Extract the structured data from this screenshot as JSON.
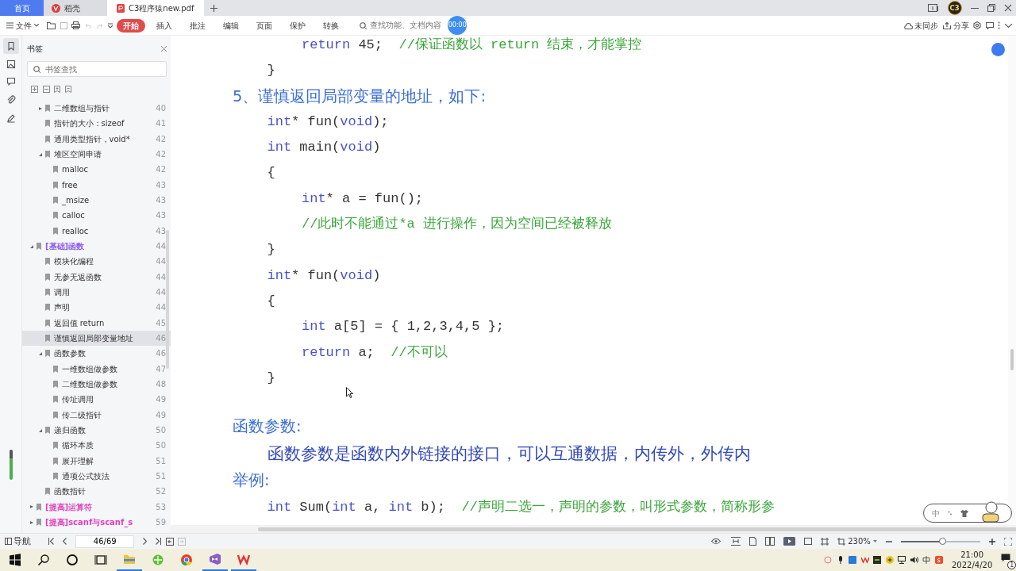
{
  "tabs": [
    {
      "label": "首页",
      "kind": "home",
      "selected": false
    },
    {
      "label": "稻壳",
      "kind": "docer",
      "selected": false
    },
    {
      "label": "C3程序猿new.pdf",
      "kind": "pdf",
      "selected": true
    }
  ],
  "window": {
    "avatar": "C3"
  },
  "toolbar": {
    "file_menu": "文件",
    "menu": [
      {
        "label": "开始",
        "selected": true
      },
      {
        "label": "插入",
        "selected": false
      },
      {
        "label": "批注",
        "selected": false
      },
      {
        "label": "编辑",
        "selected": false
      },
      {
        "label": "页面",
        "selected": false
      },
      {
        "label": "保护",
        "selected": false
      },
      {
        "label": "转换",
        "selected": false
      }
    ],
    "search": {
      "placeholder": "查找功能、文档内容"
    },
    "timer": "00:00",
    "sync": "未同步",
    "share": "分享"
  },
  "sidebar": {
    "title": "书签",
    "search": {
      "placeholder": "书签查找"
    },
    "continued_items": [
      {
        "label": "二维数组与指针",
        "page": "40",
        "expanded": false
      },
      {
        "label": "指针的大小：sizeof",
        "page": "41"
      },
      {
        "label": "通用类型指针，void*",
        "page": "42"
      },
      {
        "label": "堆区空间申请",
        "page": "42",
        "expanded": true,
        "children": [
          {
            "label": "malloc",
            "page": "42"
          },
          {
            "label": "free",
            "page": "43"
          },
          {
            "label": "_msize",
            "page": "43"
          },
          {
            "label": "calloc",
            "page": "43"
          },
          {
            "label": "realloc",
            "page": "43"
          }
        ]
      }
    ],
    "items": [
      {
        "label": "[基础]函数",
        "page": "44",
        "color": "#8a5cf0",
        "expanded": true,
        "children": [
          {
            "label": "模块化编程",
            "page": "44"
          },
          {
            "label": "无参无返函数",
            "page": "44"
          },
          {
            "label": "调用",
            "page": "44"
          },
          {
            "label": "声明",
            "page": "44"
          },
          {
            "label": "返回值 return",
            "page": "45"
          },
          {
            "label": "谨慎返回局部变量地址",
            "page": "46",
            "selected": true
          },
          {
            "label": "函数参数",
            "page": "46",
            "expanded": true,
            "children": [
              {
                "label": "一维数组做参数",
                "page": "47"
              },
              {
                "label": "二维数组做参数",
                "page": "48"
              },
              {
                "label": "传址调用",
                "page": "49"
              },
              {
                "label": "传二级指针",
                "page": "49"
              }
            ]
          },
          {
            "label": "递归函数",
            "page": "50",
            "expanded": true,
            "children": [
              {
                "label": "循环本质",
                "page": "50"
              },
              {
                "label": "展开理解",
                "page": "51"
              },
              {
                "label": "通项公式技法",
                "page": "51"
              }
            ]
          },
          {
            "label": "函数指针",
            "page": "52"
          }
        ]
      },
      {
        "label": "[提高]运算符",
        "page": "53",
        "color": "#e040c0",
        "expanded": false
      },
      {
        "label": "[提高]scanf与scanf_s",
        "page": "59",
        "color": "#e040c0",
        "expanded": false
      }
    ]
  },
  "document": {
    "sections": [
      {
        "items": [
          {
            "kind": "group",
            "lines": [
              {
                "kind": "group",
                "lines": [
                  {
                    "kind": "code",
                    "segments": [
                      {
                        "kind": "keyword",
                        "text": "return"
                      },
                      {
                        "kind": "plain",
                        "text": " 45;  "
                      },
                      {
                        "kind": "comment",
                        "text": "//保证函数以 return 结束，才能掌控"
                      }
                    ]
                  }
                ]
              },
              {
                "kind": "code",
                "segments": [
                  {
                    "kind": "plain",
                    "text": "}"
                  }
                ]
              }
            ]
          },
          {
            "kind": "heading",
            "text": "5、谨慎返回局部变量的地址，如下:"
          },
          {
            "kind": "group",
            "lines": [
              {
                "kind": "code",
                "segments": [
                  {
                    "kind": "keyword",
                    "text": "int"
                  },
                  {
                    "kind": "plain",
                    "text": "* fun("
                  },
                  {
                    "kind": "keyword",
                    "text": "void"
                  },
                  {
                    "kind": "plain",
                    "text": ");"
                  }
                ]
              },
              {
                "kind": "code",
                "segments": [
                  {
                    "kind": "keyword",
                    "text": "int"
                  },
                  {
                    "kind": "plain",
                    "text": " main("
                  },
                  {
                    "kind": "keyword",
                    "text": "void"
                  },
                  {
                    "kind": "plain",
                    "text": ")"
                  }
                ]
              },
              {
                "kind": "code",
                "segments": [
                  {
                    "kind": "plain",
                    "text": "{"
                  }
                ]
              },
              {
                "kind": "group",
                "lines": [
                  {
                    "kind": "code",
                    "segments": [
                      {
                        "kind": "keyword",
                        "text": "int"
                      },
                      {
                        "kind": "plain",
                        "text": "* a = fun();"
                      }
                    ]
                  },
                  {
                    "kind": "code",
                    "segments": [
                      {
                        "kind": "comment",
                        "text": "//此时不能通过*a 进行操作，因为空间已经被释放"
                      }
                    ]
                  }
                ]
              },
              {
                "kind": "code",
                "segments": [
                  {
                    "kind": "plain",
                    "text": "}"
                  }
                ]
              },
              {
                "kind": "code",
                "segments": [
                  {
                    "kind": "keyword",
                    "text": "int"
                  },
                  {
                    "kind": "plain",
                    "text": "* fun("
                  },
                  {
                    "kind": "keyword",
                    "text": "void"
                  },
                  {
                    "kind": "plain",
                    "text": ")"
                  }
                ]
              },
              {
                "kind": "code",
                "segments": [
                  {
                    "kind": "plain",
                    "text": "{"
                  }
                ]
              },
              {
                "kind": "group",
                "lines": [
                  {
                    "kind": "code",
                    "segments": [
                      {
                        "kind": "keyword",
                        "text": "int"
                      },
                      {
                        "kind": "plain",
                        "text": " a[5] = { 1,2,3,4,5 };"
                      }
                    ]
                  },
                  {
                    "kind": "code",
                    "segments": [
                      {
                        "kind": "keyword",
                        "text": "return"
                      },
                      {
                        "kind": "plain",
                        "text": " a;  "
                      },
                      {
                        "kind": "comment",
                        "text": "//不可以"
                      }
                    ]
                  }
                ]
              },
              {
                "kind": "code",
                "segments": [
                  {
                    "kind": "plain",
                    "text": "}"
                  }
                ]
              }
            ]
          }
        ]
      },
      {
        "items": [
          {
            "kind": "heading",
            "text": "函数参数:"
          },
          {
            "kind": "group",
            "lines": [
              {
                "kind": "para",
                "text": "函数参数是函数内外链接的接口，可以互通数据，内传外，外传内"
              }
            ]
          },
          {
            "kind": "heading",
            "text": "举例:"
          },
          {
            "kind": "group",
            "lines": [
              {
                "kind": "code",
                "segments": [
                  {
                    "kind": "keyword",
                    "text": "int"
                  },
                  {
                    "kind": "plain",
                    "text": " Sum("
                  },
                  {
                    "kind": "keyword",
                    "text": "int"
                  },
                  {
                    "kind": "plain",
                    "text": " a, "
                  },
                  {
                    "kind": "keyword",
                    "text": "int"
                  },
                  {
                    "kind": "plain",
                    "text": " b);  "
                  },
                  {
                    "kind": "comment",
                    "text": "//声明二选一，声明的参数，叫形式参数，简称形参"
                  }
                ]
              }
            ]
          }
        ]
      }
    ]
  },
  "status_bar": {
    "nav": "导航",
    "page": "46/69",
    "zoom": "230%",
    "zoom_slider": {
      "level": 0.52
    }
  },
  "ime": {
    "mode": "中"
  },
  "taskbar": {
    "time": "21:00",
    "date": "2022/4/20",
    "notifications": "1"
  }
}
